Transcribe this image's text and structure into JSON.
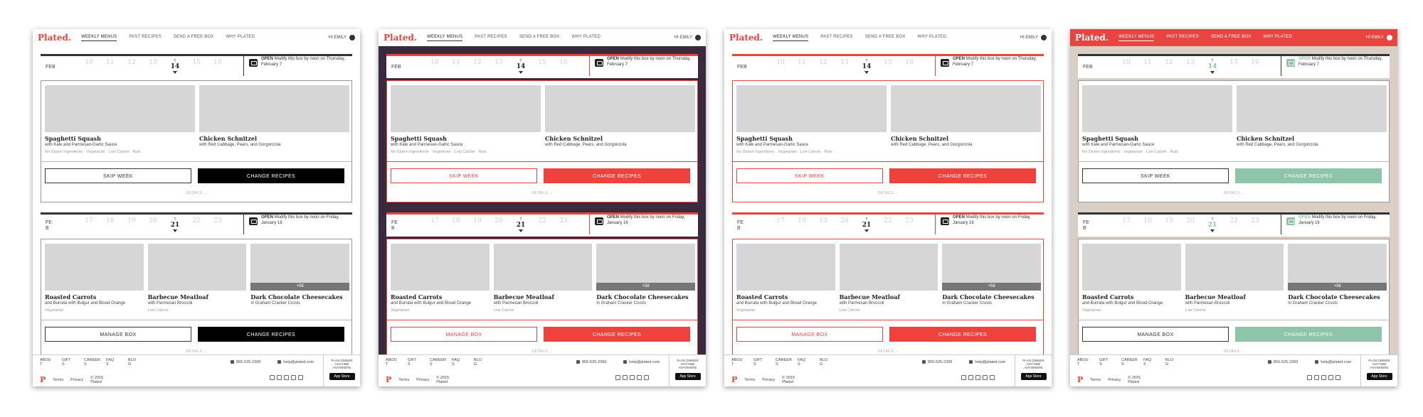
{
  "brand": "Plated.",
  "nav": [
    "WEEKLY MENUS",
    "PAST RECIPES",
    "SEND A FREE BOX",
    "WHY PLATED"
  ],
  "user": "HI EMILY",
  "week1": {
    "month": "FEB",
    "days": [
      "10",
      "11",
      "12",
      "13",
      "14",
      "15",
      "16"
    ],
    "current_index": 4,
    "current_label": "T",
    "status_label": "OPEN",
    "status_text": "Modify this box by noon on Thursday, February 7",
    "recipes": [
      {
        "title": "Spaghetti Squash",
        "subtitle": "with Kale and Parmesan-Garlic Sauce",
        "tags": "No Gluten Ingredients  ·  Vegetarian  ·  Low Calorie  ·  Nuts"
      },
      {
        "title": "Chicken Schnitzel",
        "subtitle": "with Red Cabbage, Pears, and Gorgonzola",
        "tags": ""
      }
    ],
    "btn_left": "SKIP WEEK",
    "btn_right": "CHANGE RECIPES",
    "details": "DETAILS"
  },
  "week2": {
    "month": "FE\nB",
    "days": [
      "17",
      "18",
      "19",
      "20",
      "21",
      "22",
      "23"
    ],
    "current_index": 4,
    "current_label": "T",
    "status_label": "OPEN",
    "status_text": "Modify this box by noon on Friday, January 16",
    "recipes": [
      {
        "title": "Roasted Carrots",
        "subtitle": "and Burrata with Bulgur and Blood Orange",
        "tags": "Vegetarian"
      },
      {
        "title": "Barbecue Meatloaf",
        "subtitle": "with Parmesan Broccoli",
        "tags": "Low Calorie"
      },
      {
        "title": "Dark Chocolate Cheesecakes",
        "subtitle": "in Graham Cracker Crusts",
        "tags": "",
        "more": "+58"
      }
    ],
    "btn_left": "MANAGE BOX",
    "btn_right": "CHANGE RECIPES",
    "details": "DETAILS"
  },
  "footer": {
    "links": [
      "ABOU\nT",
      "GIFT\nS",
      "CAREER\nS",
      "FAQ\nS",
      "BLO\nG"
    ],
    "phone": "855-525-2399",
    "email": "help@plated.com",
    "bottom": [
      "Terms",
      "Privacy",
      "© 2015\nPlated"
    ],
    "app_text": "PLAN DINNER\nANYTIME\nANYWHERE",
    "app_store": "App Store"
  },
  "panels": [
    {
      "variant": "white",
      "bg": "#ffffff"
    },
    {
      "variant": "red",
      "bg": "#3a2a3d"
    },
    {
      "variant": "red",
      "bg": "#ffffff"
    },
    {
      "variant": "green",
      "bg": "#d9cfc5"
    }
  ],
  "colors": {
    "accent": "#e94540",
    "green": "#8ec4a8",
    "dark_purple": "#3a2a3d",
    "beige": "#d9cfc5"
  }
}
